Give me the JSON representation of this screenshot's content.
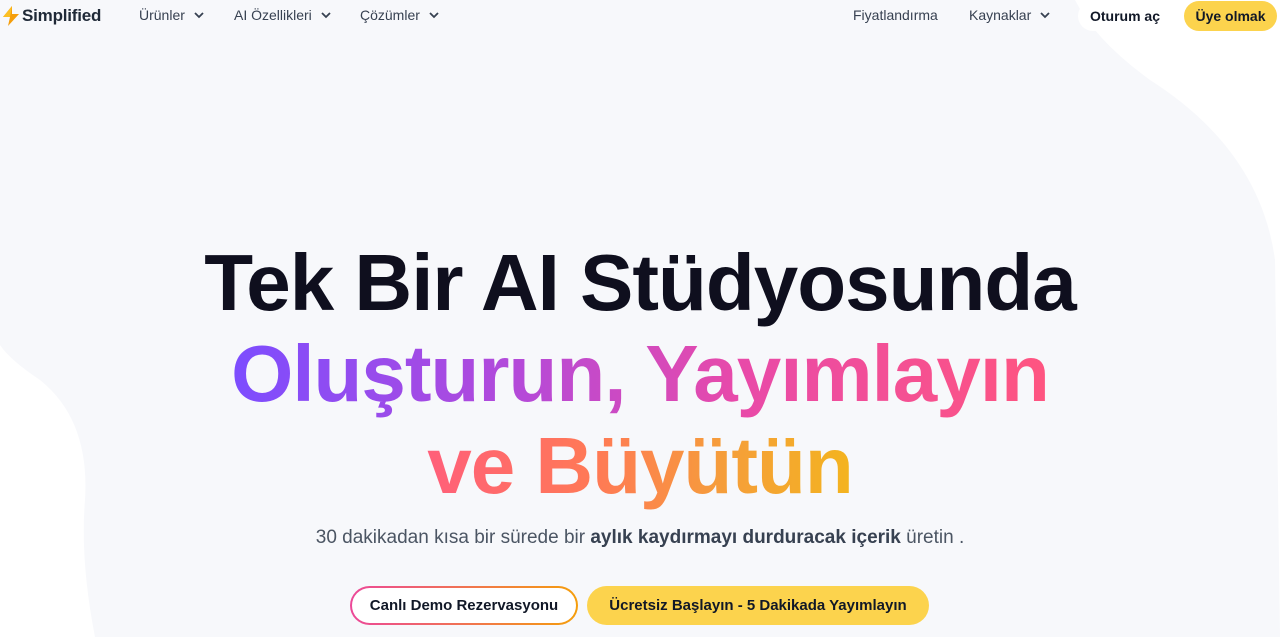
{
  "nav": {
    "logo_text": "Simplified",
    "items": [
      {
        "label": "Ürünler"
      },
      {
        "label": "AI Özellikleri"
      },
      {
        "label": "Çözümler"
      }
    ],
    "pricing": "Fiyatlandırma",
    "resources": "Kaynaklar",
    "login": "Oturum aç",
    "signup": "Üye olmak"
  },
  "hero": {
    "line1": "Tek Bir AI Stüdyosunda",
    "line2": "Oluşturun, Yayımlayın",
    "line3": "ve Büyütün",
    "sub_prefix": "30 dakikadan kısa bir sürede bir ",
    "sub_bold": "aylık kaydırmayı durduracak içerik",
    "sub_suffix": " üretin ."
  },
  "cta": {
    "demo": "Canlı Demo Rezervasyonu",
    "start": "Ücretsiz Başlayın - 5 Dakikada Yayımlayın"
  },
  "colors": {
    "accent_yellow": "#fcd34d",
    "background_blob": "#f7f8fb",
    "heading": "#0f0f1e"
  }
}
